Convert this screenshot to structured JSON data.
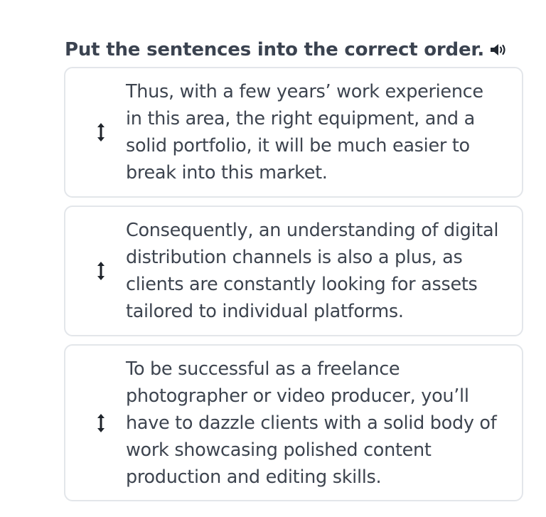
{
  "instruction": {
    "text": "Put the sentences into the correct order.",
    "audio_icon": "speaker-icon"
  },
  "sentences": [
    {
      "text": "Thus, with a few years’ work experience in this area, the right equipment, and a solid portfolio, it will be much easier to break into this market.",
      "handle_icon": "drag-handle-icon"
    },
    {
      "text": "Consequently, an understanding of digital distribution channels is also a plus, as clients are constantly looking for assets tailored to individual platforms.",
      "handle_icon": "drag-handle-icon"
    },
    {
      "text": "To be successful as a freelance photographer or video producer, you’ll have to dazzle clients with a solid body of work showcasing polished content production and editing skills.",
      "handle_icon": "drag-handle-icon"
    }
  ],
  "colors": {
    "text": "#3d444f",
    "card_border": "#e3e6ea",
    "background": "#ffffff"
  }
}
